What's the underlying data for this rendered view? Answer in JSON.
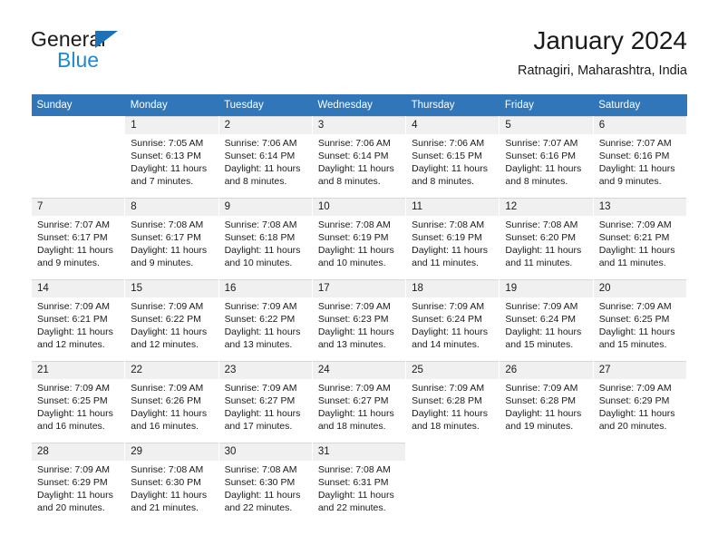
{
  "brand": {
    "name_top": "General",
    "name_bottom": "Blue",
    "triangle_color": "#1d71b8",
    "blue_color": "#1d8ad6"
  },
  "header": {
    "title": "January 2024",
    "subtitle": "Ratnagiri, Maharashtra, India"
  },
  "calendar": {
    "header_background": "#3076b8",
    "daynum_background": "#f0f0f0",
    "weekday_headers": [
      "Sunday",
      "Monday",
      "Tuesday",
      "Wednesday",
      "Thursday",
      "Friday",
      "Saturday"
    ],
    "weeks": [
      [
        {
          "day": "",
          "sunrise": "",
          "sunset": "",
          "daylight_1": "",
          "daylight_2": ""
        },
        {
          "day": "1",
          "sunrise": "Sunrise: 7:05 AM",
          "sunset": "Sunset: 6:13 PM",
          "daylight_1": "Daylight: 11 hours",
          "daylight_2": "and 7 minutes."
        },
        {
          "day": "2",
          "sunrise": "Sunrise: 7:06 AM",
          "sunset": "Sunset: 6:14 PM",
          "daylight_1": "Daylight: 11 hours",
          "daylight_2": "and 8 minutes."
        },
        {
          "day": "3",
          "sunrise": "Sunrise: 7:06 AM",
          "sunset": "Sunset: 6:14 PM",
          "daylight_1": "Daylight: 11 hours",
          "daylight_2": "and 8 minutes."
        },
        {
          "day": "4",
          "sunrise": "Sunrise: 7:06 AM",
          "sunset": "Sunset: 6:15 PM",
          "daylight_1": "Daylight: 11 hours",
          "daylight_2": "and 8 minutes."
        },
        {
          "day": "5",
          "sunrise": "Sunrise: 7:07 AM",
          "sunset": "Sunset: 6:16 PM",
          "daylight_1": "Daylight: 11 hours",
          "daylight_2": "and 8 minutes."
        },
        {
          "day": "6",
          "sunrise": "Sunrise: 7:07 AM",
          "sunset": "Sunset: 6:16 PM",
          "daylight_1": "Daylight: 11 hours",
          "daylight_2": "and 9 minutes."
        }
      ],
      [
        {
          "day": "7",
          "sunrise": "Sunrise: 7:07 AM",
          "sunset": "Sunset: 6:17 PM",
          "daylight_1": "Daylight: 11 hours",
          "daylight_2": "and 9 minutes."
        },
        {
          "day": "8",
          "sunrise": "Sunrise: 7:08 AM",
          "sunset": "Sunset: 6:17 PM",
          "daylight_1": "Daylight: 11 hours",
          "daylight_2": "and 9 minutes."
        },
        {
          "day": "9",
          "sunrise": "Sunrise: 7:08 AM",
          "sunset": "Sunset: 6:18 PM",
          "daylight_1": "Daylight: 11 hours",
          "daylight_2": "and 10 minutes."
        },
        {
          "day": "10",
          "sunrise": "Sunrise: 7:08 AM",
          "sunset": "Sunset: 6:19 PM",
          "daylight_1": "Daylight: 11 hours",
          "daylight_2": "and 10 minutes."
        },
        {
          "day": "11",
          "sunrise": "Sunrise: 7:08 AM",
          "sunset": "Sunset: 6:19 PM",
          "daylight_1": "Daylight: 11 hours",
          "daylight_2": "and 11 minutes."
        },
        {
          "day": "12",
          "sunrise": "Sunrise: 7:08 AM",
          "sunset": "Sunset: 6:20 PM",
          "daylight_1": "Daylight: 11 hours",
          "daylight_2": "and 11 minutes."
        },
        {
          "day": "13",
          "sunrise": "Sunrise: 7:09 AM",
          "sunset": "Sunset: 6:21 PM",
          "daylight_1": "Daylight: 11 hours",
          "daylight_2": "and 11 minutes."
        }
      ],
      [
        {
          "day": "14",
          "sunrise": "Sunrise: 7:09 AM",
          "sunset": "Sunset: 6:21 PM",
          "daylight_1": "Daylight: 11 hours",
          "daylight_2": "and 12 minutes."
        },
        {
          "day": "15",
          "sunrise": "Sunrise: 7:09 AM",
          "sunset": "Sunset: 6:22 PM",
          "daylight_1": "Daylight: 11 hours",
          "daylight_2": "and 12 minutes."
        },
        {
          "day": "16",
          "sunrise": "Sunrise: 7:09 AM",
          "sunset": "Sunset: 6:22 PM",
          "daylight_1": "Daylight: 11 hours",
          "daylight_2": "and 13 minutes."
        },
        {
          "day": "17",
          "sunrise": "Sunrise: 7:09 AM",
          "sunset": "Sunset: 6:23 PM",
          "daylight_1": "Daylight: 11 hours",
          "daylight_2": "and 13 minutes."
        },
        {
          "day": "18",
          "sunrise": "Sunrise: 7:09 AM",
          "sunset": "Sunset: 6:24 PM",
          "daylight_1": "Daylight: 11 hours",
          "daylight_2": "and 14 minutes."
        },
        {
          "day": "19",
          "sunrise": "Sunrise: 7:09 AM",
          "sunset": "Sunset: 6:24 PM",
          "daylight_1": "Daylight: 11 hours",
          "daylight_2": "and 15 minutes."
        },
        {
          "day": "20",
          "sunrise": "Sunrise: 7:09 AM",
          "sunset": "Sunset: 6:25 PM",
          "daylight_1": "Daylight: 11 hours",
          "daylight_2": "and 15 minutes."
        }
      ],
      [
        {
          "day": "21",
          "sunrise": "Sunrise: 7:09 AM",
          "sunset": "Sunset: 6:25 PM",
          "daylight_1": "Daylight: 11 hours",
          "daylight_2": "and 16 minutes."
        },
        {
          "day": "22",
          "sunrise": "Sunrise: 7:09 AM",
          "sunset": "Sunset: 6:26 PM",
          "daylight_1": "Daylight: 11 hours",
          "daylight_2": "and 16 minutes."
        },
        {
          "day": "23",
          "sunrise": "Sunrise: 7:09 AM",
          "sunset": "Sunset: 6:27 PM",
          "daylight_1": "Daylight: 11 hours",
          "daylight_2": "and 17 minutes."
        },
        {
          "day": "24",
          "sunrise": "Sunrise: 7:09 AM",
          "sunset": "Sunset: 6:27 PM",
          "daylight_1": "Daylight: 11 hours",
          "daylight_2": "and 18 minutes."
        },
        {
          "day": "25",
          "sunrise": "Sunrise: 7:09 AM",
          "sunset": "Sunset: 6:28 PM",
          "daylight_1": "Daylight: 11 hours",
          "daylight_2": "and 18 minutes."
        },
        {
          "day": "26",
          "sunrise": "Sunrise: 7:09 AM",
          "sunset": "Sunset: 6:28 PM",
          "daylight_1": "Daylight: 11 hours",
          "daylight_2": "and 19 minutes."
        },
        {
          "day": "27",
          "sunrise": "Sunrise: 7:09 AM",
          "sunset": "Sunset: 6:29 PM",
          "daylight_1": "Daylight: 11 hours",
          "daylight_2": "and 20 minutes."
        }
      ],
      [
        {
          "day": "28",
          "sunrise": "Sunrise: 7:09 AM",
          "sunset": "Sunset: 6:29 PM",
          "daylight_1": "Daylight: 11 hours",
          "daylight_2": "and 20 minutes."
        },
        {
          "day": "29",
          "sunrise": "Sunrise: 7:08 AM",
          "sunset": "Sunset: 6:30 PM",
          "daylight_1": "Daylight: 11 hours",
          "daylight_2": "and 21 minutes."
        },
        {
          "day": "30",
          "sunrise": "Sunrise: 7:08 AM",
          "sunset": "Sunset: 6:30 PM",
          "daylight_1": "Daylight: 11 hours",
          "daylight_2": "and 22 minutes."
        },
        {
          "day": "31",
          "sunrise": "Sunrise: 7:08 AM",
          "sunset": "Sunset: 6:31 PM",
          "daylight_1": "Daylight: 11 hours",
          "daylight_2": "and 22 minutes."
        },
        {
          "day": "",
          "sunrise": "",
          "sunset": "",
          "daylight_1": "",
          "daylight_2": ""
        },
        {
          "day": "",
          "sunrise": "",
          "sunset": "",
          "daylight_1": "",
          "daylight_2": ""
        },
        {
          "day": "",
          "sunrise": "",
          "sunset": "",
          "daylight_1": "",
          "daylight_2": ""
        }
      ]
    ]
  }
}
